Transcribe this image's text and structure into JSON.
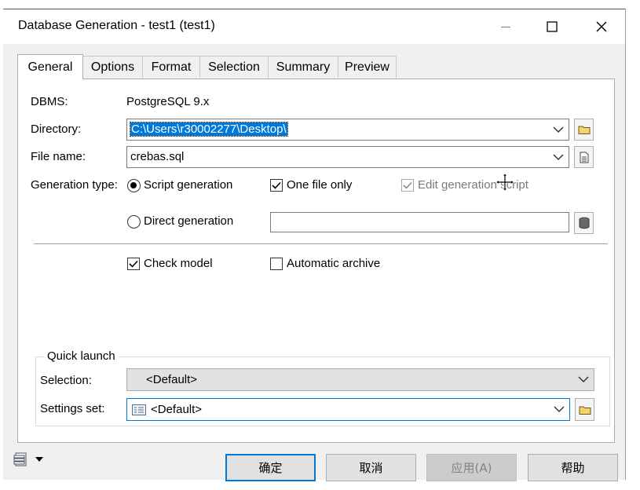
{
  "window": {
    "title": "Database Generation - test1 (test1)",
    "controls": {
      "minimize": "minimize-icon",
      "maximize": "maximize-icon",
      "close": "close-icon"
    }
  },
  "tabs": [
    "General",
    "Options",
    "Format",
    "Selection",
    "Summary",
    "Preview"
  ],
  "active_tab": "General",
  "general": {
    "dbms_label": "DBMS:",
    "dbms_value": "PostgreSQL 9.x",
    "directory_label": "Directory:",
    "directory_value": "C:\\Users\\r30002277\\Desktop\\",
    "filename_label": "File name:",
    "filename_value": "crebas.sql",
    "generation_type_label": "Generation type:",
    "script_generation": "Script generation",
    "direct_generation": "Direct generation",
    "one_file_only": "One file only",
    "edit_generation_script": "Edit generation script",
    "check_model": "Check model",
    "automatic_archive": "Automatic archive",
    "direct_connection_value": ""
  },
  "quick_launch": {
    "title": "Quick launch",
    "selection_label": "Selection:",
    "selection_value": "<Default>",
    "settings_set_label": "Settings set:",
    "settings_set_value": "<Default>"
  },
  "footer": {
    "ok": "确定",
    "cancel": "取消",
    "apply": "应用(A)",
    "help": "帮助"
  },
  "colors": {
    "accent": "#0078d7",
    "dialog_bg": "#f0f0f0",
    "panel_bg": "#ffffff"
  }
}
